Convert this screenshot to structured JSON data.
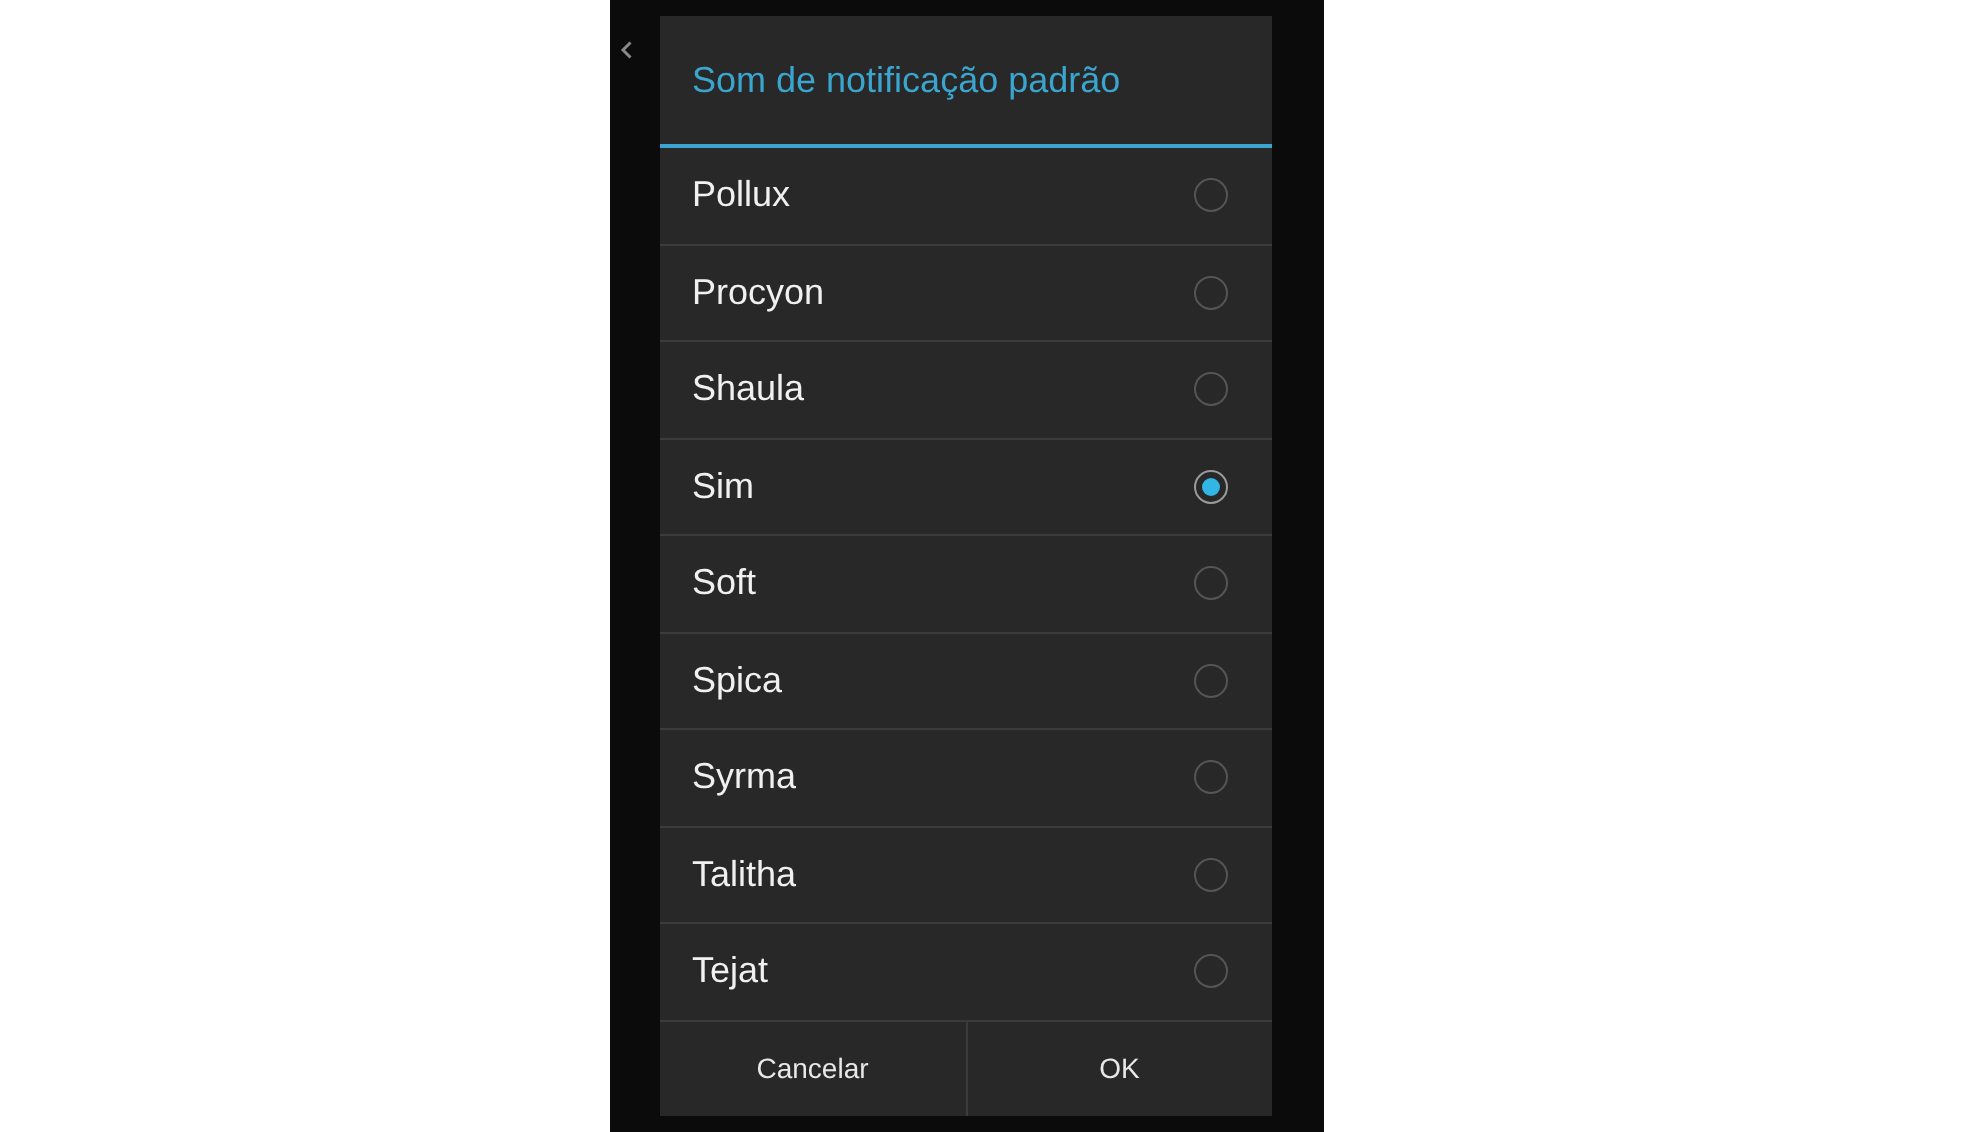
{
  "dialog": {
    "title": "Som de notificação padrão",
    "options": [
      {
        "label": "Pollux",
        "selected": false
      },
      {
        "label": "Procyon",
        "selected": false
      },
      {
        "label": "Shaula",
        "selected": false
      },
      {
        "label": "Sim",
        "selected": true
      },
      {
        "label": "Soft",
        "selected": false
      },
      {
        "label": "Spica",
        "selected": false
      },
      {
        "label": "Syrma",
        "selected": false
      },
      {
        "label": "Talitha",
        "selected": false
      },
      {
        "label": "Tejat",
        "selected": false
      }
    ],
    "buttons": [
      "Cancelar",
      "OK"
    ]
  }
}
